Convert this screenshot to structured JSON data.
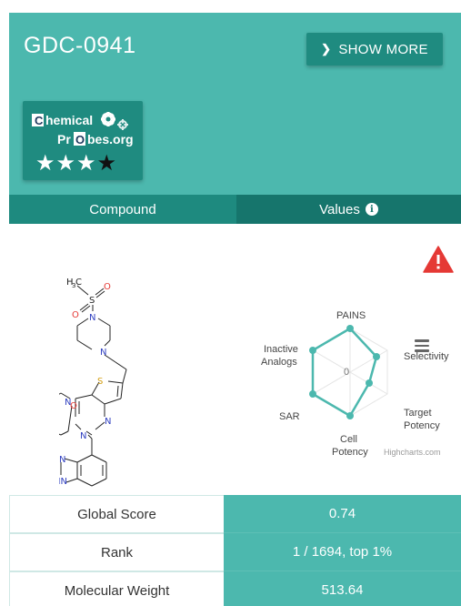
{
  "header": {
    "title": "GDC-0941",
    "show_more_label": "SHOW MORE",
    "logo": {
      "line1": "hemical",
      "line1_initial": "C",
      "line2_pre": "Pr",
      "line2_initial": "O",
      "line2_post": "bes.org"
    },
    "rating": {
      "value": 3,
      "max": 4
    }
  },
  "tabs": [
    {
      "label": "Compound"
    },
    {
      "label": "Values"
    }
  ],
  "structure_labels": {
    "methyl": "H",
    "methyl_sub": "3",
    "methyl_c": "C",
    "sulfur_sulfonyl": "S",
    "oxygen_a": "O",
    "oxygen_b": "O",
    "n_pip_top": "N",
    "n_pip_bottom": "N",
    "oxygen_morph": "O",
    "n_morph": "N",
    "sulfur_thio": "S",
    "n_ring_left": "N",
    "n_ring_right": "N",
    "n_indazole": "N",
    "nh_indazole": "HN"
  },
  "radar": {
    "axes": [
      "PAINS",
      "Selectivity",
      "Target Potency",
      "Cell Potency",
      "SAR",
      "Inactive Analogs"
    ],
    "axis_labels": {
      "pains": "PAINS",
      "selectivity": "Selectivity",
      "target_line1": "Target",
      "target_line2": "Potency",
      "cell_line1": "Cell",
      "cell_line2": "Potency",
      "sar": "SAR",
      "inactive_line1": "Inactive",
      "inactive_line2": "Analogs"
    },
    "center_label": "0",
    "credit": "Highcharts.com",
    "series_color": "#4cb8ae"
  },
  "table": [
    {
      "label": "Global Score",
      "value": "0.74"
    },
    {
      "label": "Rank",
      "value": "1 / 1694, top 1%"
    },
    {
      "label": "Molecular Weight",
      "value": "513.64"
    }
  ],
  "colors": {
    "header_bg": "#4cb8ae",
    "accent_dark": "#1f8b80",
    "warning": "#e53935"
  },
  "icons": [
    "chevron-right-icon",
    "gear-icon",
    "star-icon",
    "info-icon",
    "warning-icon",
    "menu-icon"
  ]
}
